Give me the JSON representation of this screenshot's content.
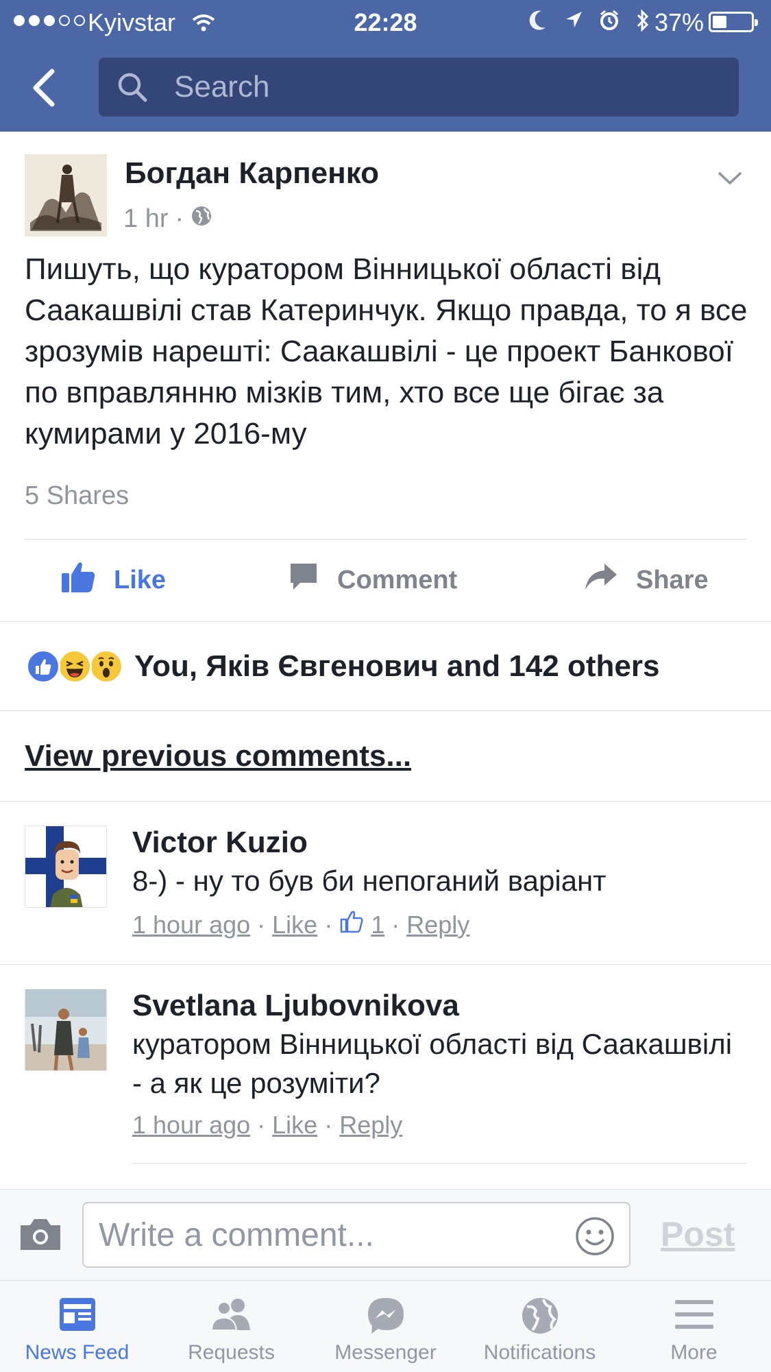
{
  "status_bar": {
    "carrier": "Kyivstar",
    "time": "22:28",
    "battery": "37%",
    "battery_level": 0.37,
    "signal_bars_filled": 3,
    "signal_bars_total": 5
  },
  "header": {
    "search_placeholder": "Search"
  },
  "post": {
    "author": "Богдан Карпенко",
    "time": "1 hr",
    "separator": "·",
    "text": "Пишуть, що куратором Вінницької області від Саакашвілі став Катеринчук. Якщо правда, то я все зрозумів нарешті: Саакашвілі - це проект Банкової по вправлянню мізків тим, хто все ще бігає за кумирами у 2016-му",
    "shares": "5 Shares",
    "actions": {
      "like": "Like",
      "comment": "Comment",
      "share": "Share"
    },
    "reactions_summary": "You, Яків Євгенович and 142 others"
  },
  "comments_section": {
    "view_previous": "View previous comments...",
    "comments": [
      {
        "author": "Victor Kuzio",
        "text": "8-) - ну то був би непоганий варіант",
        "time": "1 hour ago",
        "like": "Like",
        "like_count": "1",
        "reply": "Reply"
      },
      {
        "author": "Svetlana Ljubovnikova",
        "text": "куратором Вінницької області від Саакашвілі - а як це розуміти?",
        "time": "1 hour ago",
        "like": "Like",
        "reply": "Reply"
      }
    ]
  },
  "composer": {
    "placeholder": "Write a comment...",
    "post_label": "Post"
  },
  "tabbar": {
    "tabs": [
      {
        "label": "News Feed",
        "icon": "news-feed-icon",
        "active": true
      },
      {
        "label": "Requests",
        "icon": "requests-icon",
        "active": false
      },
      {
        "label": "Messenger",
        "icon": "messenger-icon",
        "active": false
      },
      {
        "label": "Notifications",
        "icon": "globe-icon",
        "active": false
      },
      {
        "label": "More",
        "icon": "menu-icon",
        "active": false
      }
    ]
  },
  "colors": {
    "header_bg": "#4b67a6",
    "search_bg": "#344677",
    "accent_blue": "#4a76e0",
    "meta_gray": "#90949c"
  }
}
